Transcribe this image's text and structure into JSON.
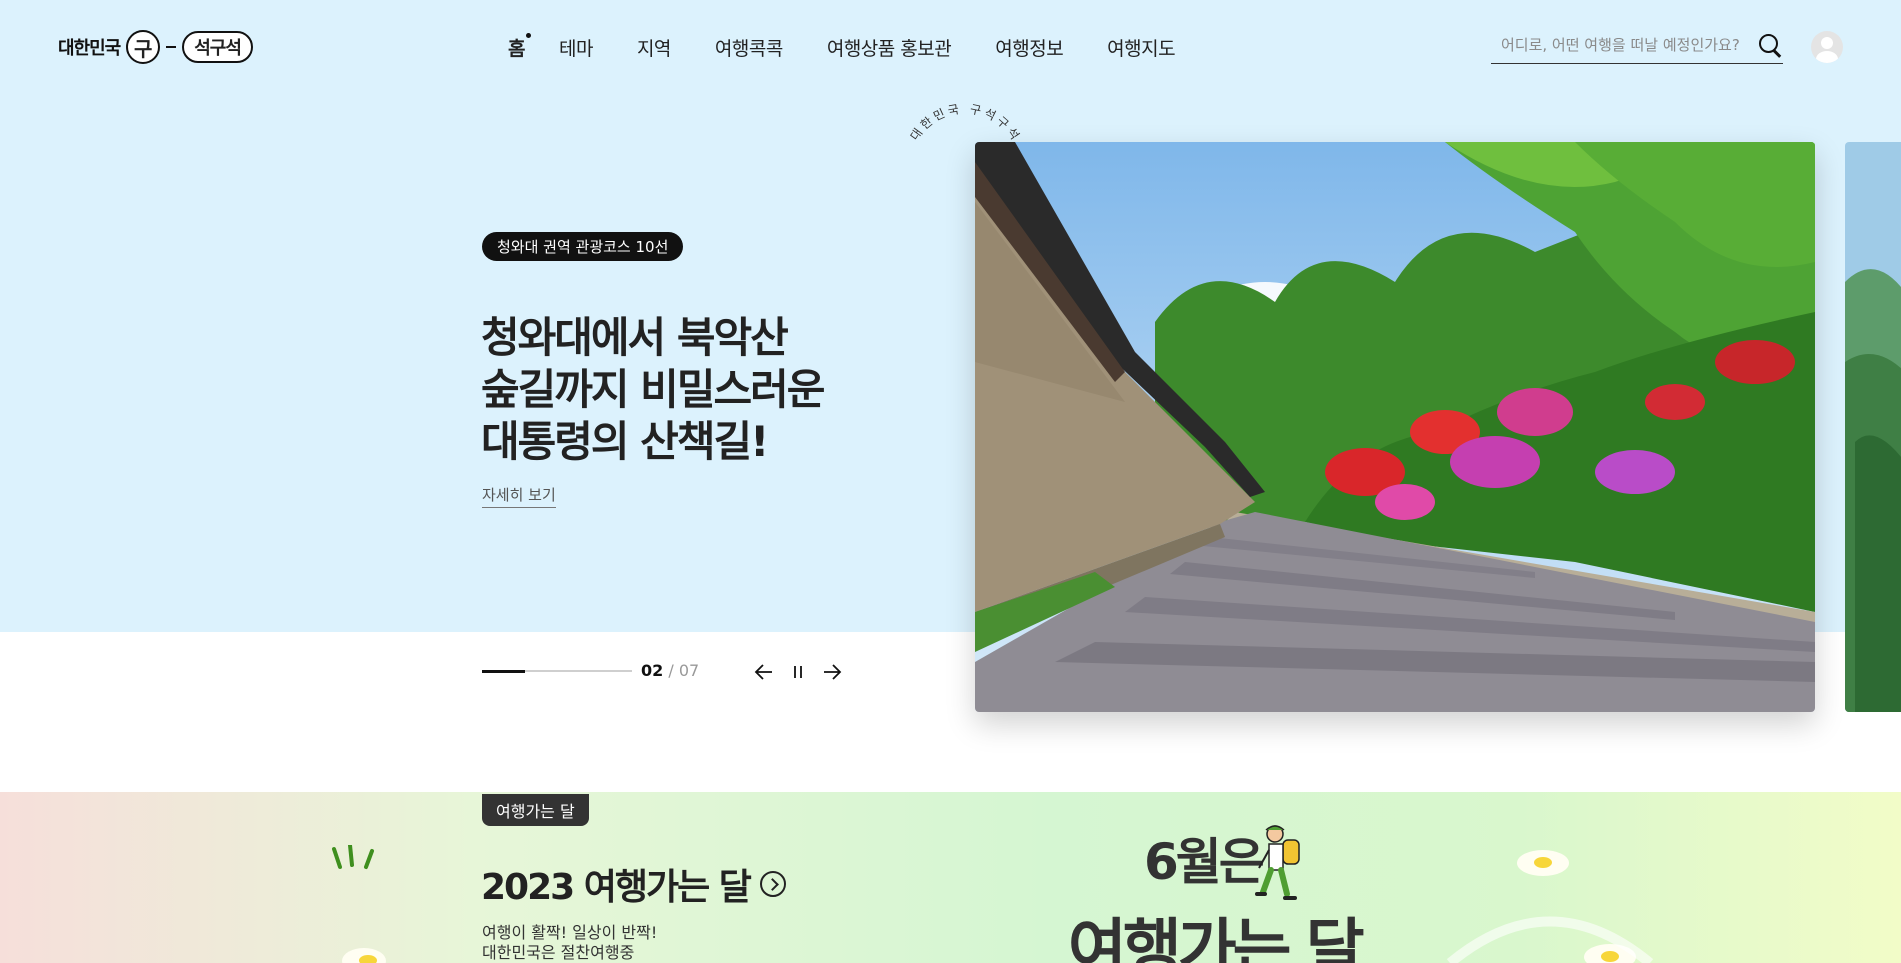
{
  "header": {
    "logo": {
      "left_text": "대한민국",
      "circle_char": "구",
      "pill_text": "석구석"
    },
    "nav": [
      {
        "label": "홈",
        "active": true
      },
      {
        "label": "테마"
      },
      {
        "label": "지역"
      },
      {
        "label": "여행콕콕"
      },
      {
        "label": "여행상품 홍보관"
      },
      {
        "label": "여행정보"
      },
      {
        "label": "여행지도"
      }
    ],
    "search": {
      "placeholder": "어디로, 어떤 여행을 떠날 예정인가요?",
      "icon": "search-icon"
    },
    "avatar_icon": "user-avatar-icon"
  },
  "hero": {
    "badge": "청와대 권역 관광코스 10선",
    "title_lines": [
      "청와대에서 북악산",
      "숲길까지 비밀스러운",
      "대통령의 산책길!"
    ],
    "more_link": "자세히 보기",
    "circle_text": "대한민국 구석구석 · ",
    "slide": {
      "current": "02",
      "separator": "/",
      "total": "07",
      "progress": 0.2857
    },
    "controls": {
      "prev_icon": "arrow-left-icon",
      "pause_icon": "pause-icon",
      "next_icon": "arrow-right-icon"
    }
  },
  "lower": {
    "badge": "여행가는 달",
    "title": "2023 여행가는 달",
    "title_icon": "arrow-circle-icon",
    "subtitle_lines": [
      "여행이 활짝! 일상이 반짝!",
      "대한민국은 절찬여행중"
    ],
    "promo_line1": "6월은",
    "promo_line2": "여행가는 달"
  },
  "colors": {
    "hero_bg": "#dcf2fd",
    "badge_bg": "#111111",
    "lower_badge_bg": "#333333"
  }
}
